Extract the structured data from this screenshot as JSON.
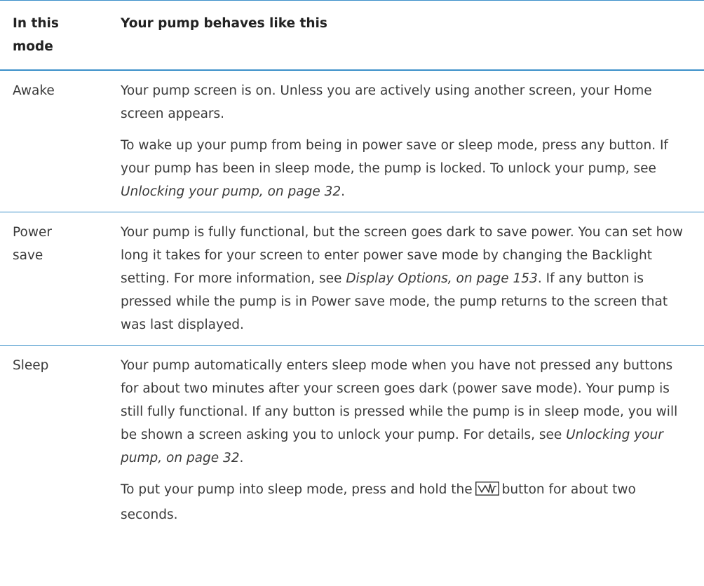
{
  "header": {
    "col1_line1": "In this",
    "col1_line2": "mode",
    "col2": "Your pump behaves like this"
  },
  "rows": [
    {
      "mode": "Awake",
      "p1": "Your pump screen is on. Unless you are actively using another screen, your Home screen appears.",
      "p2_text1": "To wake up your pump from being in power save or sleep mode, press any button. If your pump has been in sleep mode, the pump is locked. To unlock your pump, see ",
      "p2_link": "Unlocking your pump, on page 32",
      "p2_text2": "."
    },
    {
      "mode_line1": "Power",
      "mode_line2": "save",
      "p1_text1": "Your pump is fully functional, but the screen goes dark to save power. You can set how long it takes for your screen to enter power save mode by changing the Backlight setting. For more information, see ",
      "p1_link": "Display Options, on page 153",
      "p1_text2": ". If any button is pressed while the pump is in Power save mode, the pump returns to the screen that was last displayed."
    },
    {
      "mode": "Sleep",
      "p1_text1": "Your pump automatically enters sleep mode when you have not pressed any buttons for about two minutes after your screen goes dark (power save mode). Your pump is still fully functional. If any button is pressed while the pump is in sleep mode, you will be shown a screen asking you to unlock your pump. For details, see ",
      "p1_link": "Unlocking your pump, on page 32",
      "p1_text2": ".",
      "p2_text1": "To put your pump into sleep mode, press and hold the",
      "p2_icon": "activity-button-icon",
      "p2_text2": "button for about two seconds."
    }
  ],
  "colors": {
    "rule": "#3b8fc9",
    "text": "#3a3a3a",
    "heading": "#222222"
  }
}
